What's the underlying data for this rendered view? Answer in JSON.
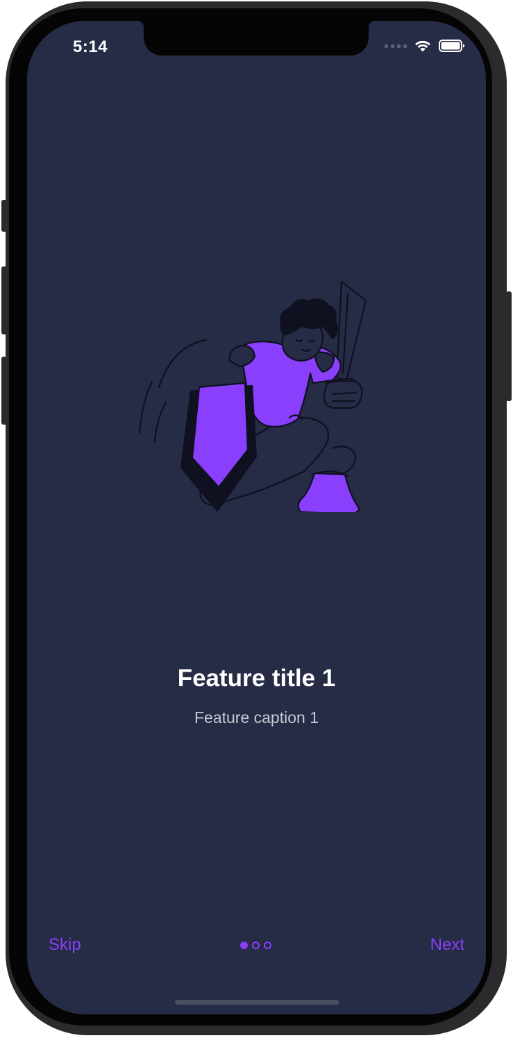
{
  "status_bar": {
    "time": "5:14"
  },
  "onboarding": {
    "title": "Feature title 1",
    "caption": "Feature caption 1",
    "current_page": 1,
    "total_pages": 3
  },
  "footer": {
    "skip_label": "Skip",
    "next_label": "Next"
  },
  "colors": {
    "background": "#262b46",
    "accent": "#8a3ffc",
    "title": "#ffffff",
    "caption": "#c7c9d4"
  },
  "illustration": {
    "icon": "knight-with-shield-and-sword-illustration"
  }
}
